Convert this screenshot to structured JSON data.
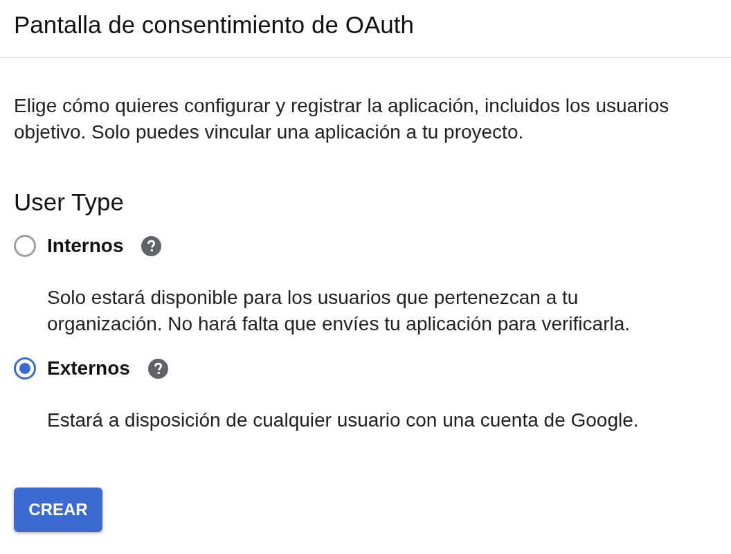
{
  "header": {
    "title": "Pantalla de consentimiento de OAuth"
  },
  "intro": "Elige cómo quieres configurar y registrar la aplicación, incluidos los usuarios objetivo. Solo puedes vincular una aplicación a tu proyecto.",
  "user_type": {
    "heading": "User Type",
    "options": [
      {
        "label": "Internos",
        "selected": false,
        "description": "Solo estará disponible para los usuarios que pertenezcan a tu organización. No hará falta que envíes tu aplicación para verificarla."
      },
      {
        "label": "Externos",
        "selected": true,
        "description": "Estará a disposición de cualquier usuario con una cuenta de Google."
      }
    ]
  },
  "create_button": {
    "label": "CREAR"
  }
}
